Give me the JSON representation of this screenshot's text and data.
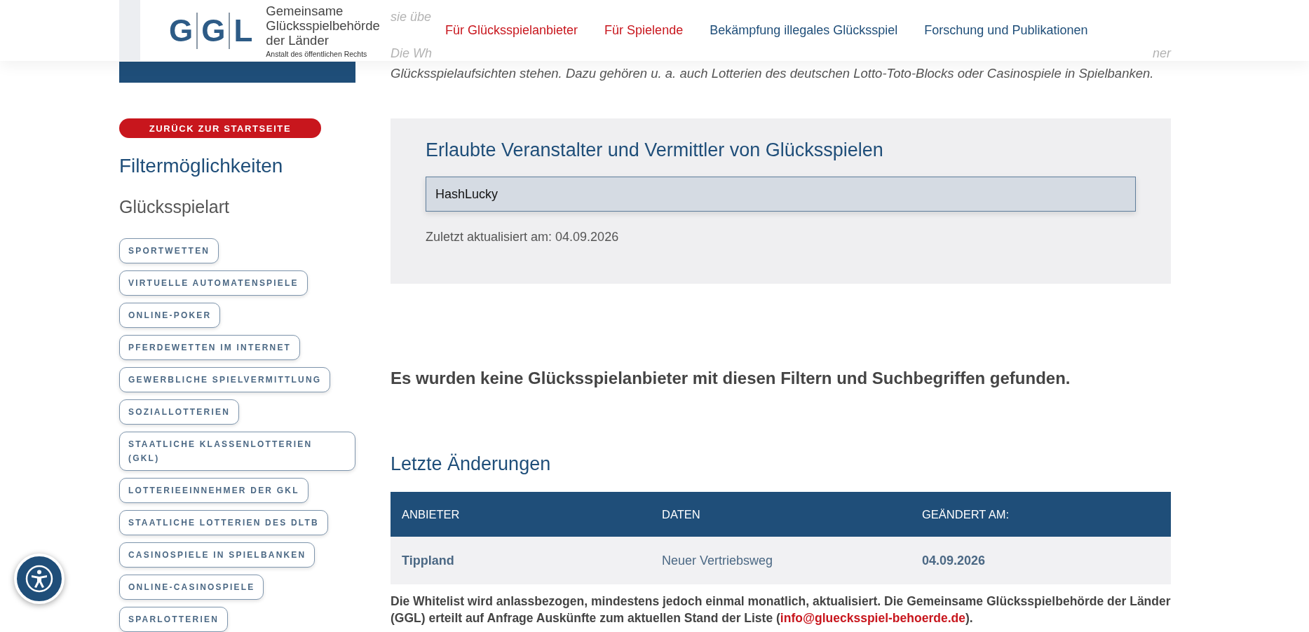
{
  "header": {
    "logo": {
      "letters": [
        "G",
        "G",
        "L"
      ],
      "name_lines": [
        "Gemeinsame",
        "Glücksspielbehörde",
        "der Länder"
      ],
      "subtitle": "Anstalt des öffentlichen Rechts"
    },
    "nav": [
      {
        "label": "Für Glücksspielanbieter",
        "kind": "primary"
      },
      {
        "label": "Für Spielende",
        "kind": "primary"
      },
      {
        "label": "Bekämpfung illegales Glücksspiel",
        "kind": "secondary"
      },
      {
        "label": "Forschung und Publikationen",
        "kind": "secondary"
      }
    ]
  },
  "intro": {
    "covered_line_1": "sie übe",
    "covered_line_2_start": "Die Wh",
    "covered_line_2_end": "ner",
    "visible_line": "Glücksspielaufsichten stehen. Dazu gehören u. a. auch Lotterien des deutschen Lotto-Toto-Blocks oder Casinospiele in Spielbanken."
  },
  "sidebar": {
    "back_button": "ZURÜCK ZUR STARTSEITE",
    "title": "Filtermöglichkeiten",
    "section": "Glücksspielart",
    "filters": [
      {
        "label": "SPORTWETTEN",
        "selected": false
      },
      {
        "label": "VIRTUELLE AUTOMATENSPIELE",
        "selected": false
      },
      {
        "label": "ONLINE-POKER",
        "selected": false
      },
      {
        "label": "PFERDEWETTEN IM INTERNET",
        "selected": false
      },
      {
        "label": "GEWERBLICHE SPIELVERMITTLUNG",
        "selected": false
      },
      {
        "label": "SOZIALLOTTERIEN",
        "selected": false
      },
      {
        "label": "STAATLICHE KLASSENLOTTERIEN (GKL)",
        "selected": false
      },
      {
        "label": "LOTTERIEEINNEHMER DER GKL",
        "selected": false
      },
      {
        "label": "STAATLICHE LOTTERIEN DES DLTB",
        "selected": false
      },
      {
        "label": "CASINOSPIELE IN SPIELBANKEN",
        "selected": false
      },
      {
        "label": "ONLINE-CASINOSPIELE",
        "selected": false
      },
      {
        "label": "SPARLOTTERIEN",
        "selected": false
      }
    ]
  },
  "search_panel": {
    "title": "Erlaubte Veranstalter und Vermittler von Glücksspielen",
    "search_value": "HashLucky",
    "updated": "Zuletzt aktualisiert am: 04.09.2026"
  },
  "no_results": "Es wurden keine Glücksspielanbieter mit diesen Filtern und Suchbegriffen gefunden.",
  "changes": {
    "title": "Letzte Änderungen",
    "columns": [
      "ANBIETER",
      "DATEN",
      "GEÄNDERT AM:"
    ],
    "rows": [
      {
        "provider": "Tippland",
        "data": "Neuer Vertriebsweg",
        "changed": "04.09.2026"
      }
    ]
  },
  "footnote": {
    "text_before": "Die Whitelist wird anlassbezogen, mindestens jedoch einmal monatlich, aktualisiert. Die Gemeinsame Glücksspielbehörde der Länder (GGL) erteilt auf Anfrage Auskünfte zum aktuellen Stand der Liste (",
    "link": "info@gluecksspiel-behoerde.de",
    "text_after": ")."
  }
}
